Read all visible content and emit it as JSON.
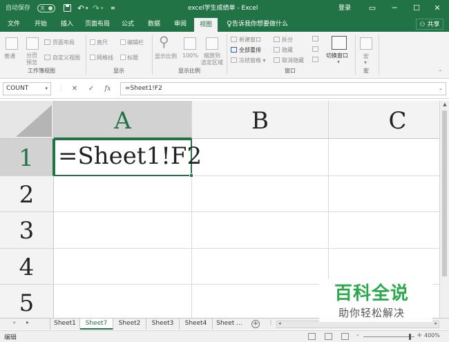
{
  "title_bar": {
    "autosave_label": "自动保存",
    "autosave_state": "关",
    "undo_icon": "undo-icon",
    "redo_icon": "redo-icon",
    "doc_title": "excel学生成绩单  -  Excel",
    "login_label": "登录",
    "controls": [
      "restore-ribbon-icon",
      "minimize-icon",
      "maximize-icon",
      "close-icon"
    ]
  },
  "ribbon_tabs": [
    "文件",
    "开始",
    "插入",
    "页面布局",
    "公式",
    "数据",
    "审阅",
    "视图"
  ],
  "active_tab": "视图",
  "tell_me": "告诉我你想要做什么",
  "share_label": "共享",
  "ribbon": {
    "workbook_views": {
      "group_label": "工作簿视图",
      "normal": "普通",
      "page_break_1": "分页",
      "page_break_2": "预览",
      "page_layout": "页面布局",
      "custom_views": "自定义视图"
    },
    "show": {
      "group_label": "显示",
      "ruler": "直尺",
      "formula_bar": "编辑栏",
      "gridlines": "网格线",
      "headings": "标题"
    },
    "zoom": {
      "group_label": "显示比例",
      "zoom": "显示比例",
      "zoom100": "100%",
      "zoom_sel_1": "缩放到",
      "zoom_sel_2": "选定区域"
    },
    "window": {
      "group_label": "窗口",
      "new_window": "新建窗口",
      "arrange_all": "全部重排",
      "freeze_panes": "冻结窗格",
      "split": "拆分",
      "hide": "隐藏",
      "unhide": "取消隐藏",
      "switch_windows": "切换窗口"
    },
    "macros": {
      "group_label": "宏",
      "macros": "宏"
    }
  },
  "formula_bar": {
    "name_box": "COUNT",
    "cancel": "✕",
    "enter": "✓",
    "fx": "fx",
    "formula": "=Sheet1!F2"
  },
  "grid": {
    "columns": [
      "A",
      "B",
      "C"
    ],
    "rows": [
      "1",
      "2",
      "3",
      "4",
      "5"
    ],
    "active_cell_text": "=Sheet1!F2"
  },
  "sheets": [
    "Sheet1",
    "Sheet7",
    "Sheet2",
    "Sheet3",
    "Sheet4",
    "Sheet ..."
  ],
  "active_sheet": "Sheet7",
  "status": {
    "mode": "编辑",
    "zoom": "400%",
    "zoom_minus": "-",
    "zoom_plus": "+"
  },
  "watermark": {
    "line1": "百科全说",
    "line2": "助你轻松解决"
  },
  "colors": {
    "excel_green": "#217346",
    "watermark_green": "#2aa84b"
  }
}
